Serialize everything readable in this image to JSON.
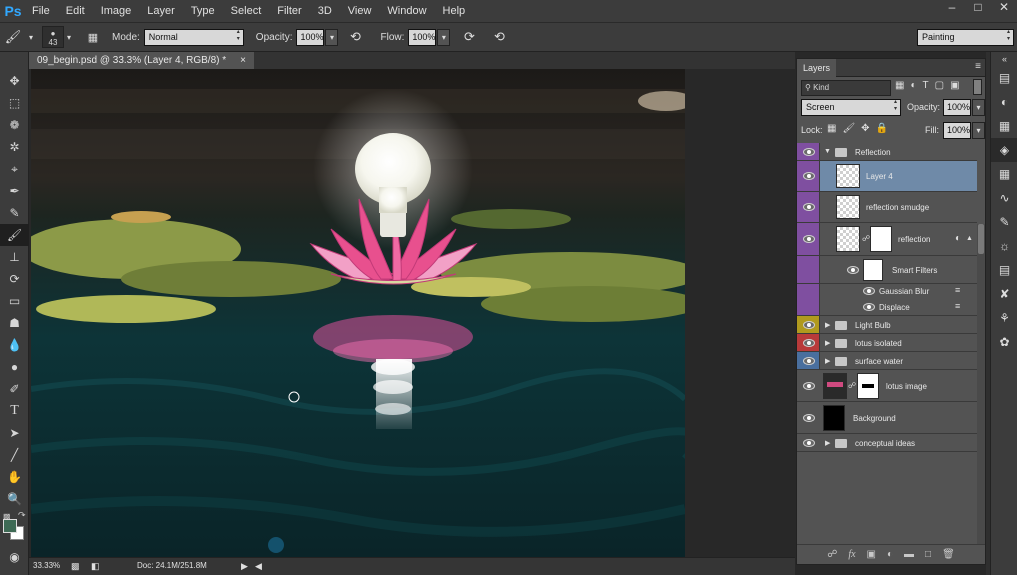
{
  "app": {
    "logo": "Ps"
  },
  "menu": [
    "File",
    "Edit",
    "Image",
    "Layer",
    "Type",
    "Select",
    "Filter",
    "3D",
    "View",
    "Window",
    "Help"
  ],
  "window_controls": [
    "minimize",
    "restore",
    "close"
  ],
  "options_bar": {
    "brush_size": "43",
    "mode_label": "Mode:",
    "mode_value": "Normal",
    "opacity_label": "Opacity:",
    "opacity_value": "100%",
    "flow_label": "Flow:",
    "flow_value": "100%",
    "workspace": "Painting"
  },
  "document": {
    "tab_title": "09_begin.psd @ 33.3% (Layer 4, RGB/8) *",
    "tab_close": "×"
  },
  "status": {
    "zoom": "33.33%",
    "doc": "Doc: 24.1M/251.8M"
  },
  "tools": [
    "move-tool",
    "marquee-tool",
    "lasso-tool",
    "quick-select-tool",
    "crop-tool",
    "eyedropper-tool",
    "spot-heal-tool",
    "brush-tool",
    "clone-stamp-tool",
    "history-brush-tool",
    "eraser-tool",
    "paint-bucket-tool",
    "blur-tool",
    "dodge-tool",
    "pen-tool",
    "type-tool",
    "path-select-tool",
    "line-tool",
    "hand-tool",
    "zoom-tool"
  ],
  "colors": {
    "foreground": "#3e6a55",
    "background": "#ffffff",
    "selection": "#6f8aa8"
  },
  "layers_panel": {
    "tab": "Layers",
    "filter": "Kind",
    "blend_mode": "Screen",
    "opacity_label": "Opacity:",
    "opacity_value": "100%",
    "lock_label": "Lock:",
    "fill_label": "Fill:",
    "fill_value": "100%",
    "layers": [
      {
        "name": "Reflection",
        "kind": "group-open",
        "tag": "#7f4fa0"
      },
      {
        "name": "Layer 4",
        "kind": "layer",
        "tag": "#7f4fa0",
        "selected": true
      },
      {
        "name": "reflection smudge",
        "kind": "layer",
        "tag": "#7f4fa0"
      },
      {
        "name": "reflection",
        "kind": "smart",
        "tag": "#7f4fa0"
      },
      {
        "name": "Smart Filters",
        "kind": "filter-head",
        "tag": "#7f4fa0"
      },
      {
        "name": "Gaussian Blur",
        "kind": "filter",
        "tag": "#7f4fa0"
      },
      {
        "name": "Displace",
        "kind": "filter",
        "tag": "#7f4fa0"
      },
      {
        "name": "Light Bulb",
        "kind": "group",
        "tag": "#b09a1e"
      },
      {
        "name": "lotus isolated",
        "kind": "group",
        "tag": "#b83a3a"
      },
      {
        "name": "surface water",
        "kind": "group",
        "tag": "#4a6f9e"
      },
      {
        "name": "lotus image",
        "kind": "masked",
        "tag": "none"
      },
      {
        "name": "Background",
        "kind": "background",
        "tag": "none"
      },
      {
        "name": "conceptual ideas",
        "kind": "group",
        "tag": "none"
      }
    ]
  }
}
